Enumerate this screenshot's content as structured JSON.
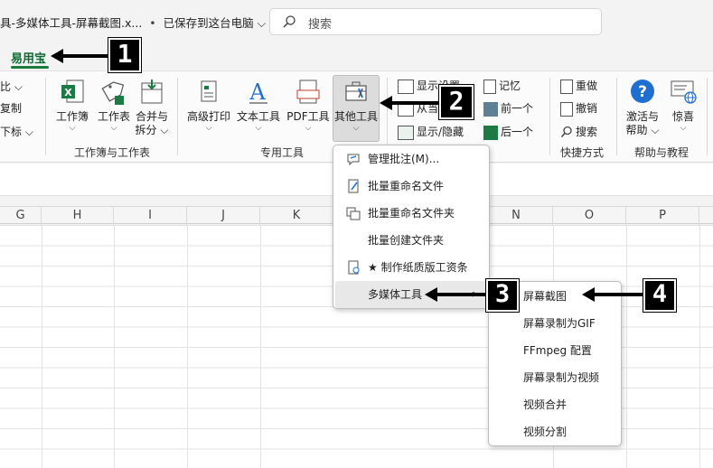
{
  "titlebar": {
    "doc_title": "具-多媒体工具-屏幕截图.x...",
    "dot": "•",
    "save_status": "已保存到这台电脑",
    "save_chevron": "⌵",
    "search_placeholder": "搜索"
  },
  "tabs": {
    "active": "易用宝"
  },
  "ribbon": {
    "left_partial": [
      "比 ⌵",
      "复制",
      "下标 ⌵"
    ],
    "group1": {
      "buttons": [
        {
          "label1": "工作簿",
          "label2": "⌵"
        },
        {
          "label1": "工作表",
          "label2": "⌵"
        },
        {
          "label1": "合并与",
          "label2": "拆分 ⌵"
        }
      ],
      "label": "工作簿与工作表"
    },
    "group2": {
      "buttons": [
        {
          "label": "高级打印",
          "chev": "⌵"
        },
        {
          "label": "文本工具",
          "chev": "⌵"
        },
        {
          "label": "PDF工具",
          "chev": "⌵"
        },
        {
          "label": "其他工具",
          "chev": "⌵"
        }
      ],
      "label": "专用工具"
    },
    "group3": {
      "items": [
        {
          "label": "显示设置"
        },
        {
          "label": "从当..."
        },
        {
          "label": "显示/隐藏"
        },
        {
          "label": "记忆"
        },
        {
          "label": "前一个"
        },
        {
          "label": "后一个"
        }
      ]
    },
    "group4": {
      "items": [
        {
          "label": "重做"
        },
        {
          "label": "撤销"
        },
        {
          "label": "搜索"
        }
      ],
      "label": "快捷方式"
    },
    "group5": {
      "buttons": [
        {
          "label1": "激活与",
          "label2": "帮助 ⌵"
        },
        {
          "label1": "惊喜",
          "label2": "⌵"
        }
      ],
      "label": "帮助与教程"
    }
  },
  "columns": [
    "G",
    "H",
    "I",
    "J",
    "K",
    "N",
    "O",
    "P"
  ],
  "menu_other_tools": [
    {
      "label": "管理批注(M)..."
    },
    {
      "label": "批量重命名文件"
    },
    {
      "label": "批量重命名文件夹"
    },
    {
      "label": "批量创建文件夹"
    },
    {
      "label": "★ 制作纸质版工资条"
    },
    {
      "label": "多媒体工具",
      "arrow": ">"
    }
  ],
  "menu_multimedia": [
    {
      "label": "屏幕截图"
    },
    {
      "label": "屏幕录制为GIF"
    },
    {
      "label": "FFmpeg 配置"
    },
    {
      "label": "屏幕录制为视频"
    },
    {
      "label": "视频合并"
    },
    {
      "label": "视频分割"
    }
  ],
  "callouts": [
    "1",
    "2",
    "3",
    "4"
  ],
  "colors": {
    "green_tab": "#0f6b32",
    "excel_green": "#1d7a45",
    "help_blue": "#1f6fd1",
    "pdf_red": "#c43b2f"
  }
}
